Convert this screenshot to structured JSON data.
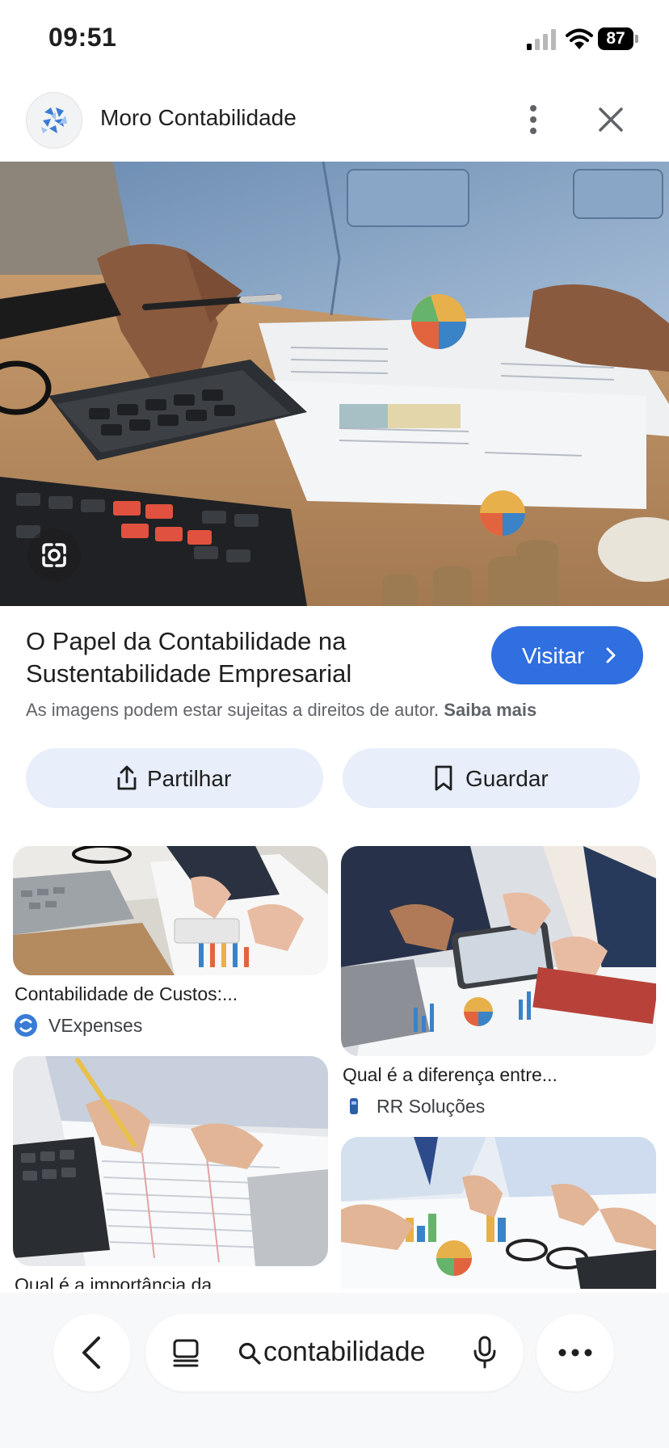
{
  "status_bar": {
    "time": "09:51",
    "battery": "87"
  },
  "header": {
    "site_name": "Moro Contabilidade"
  },
  "result": {
    "title_line1": "O Papel da Contabilidade na",
    "title_line2": "Sustentabilidade Empresarial",
    "visit_label": "Visitar",
    "copyright_text": "As imagens podem estar sujeitas a direitos de autor.",
    "learn_more": "Saiba mais",
    "share_label": "Partilhar",
    "save_label": "Guardar"
  },
  "related": [
    {
      "title": "Contabilidade de Custos:...",
      "source": "VExpenses"
    },
    {
      "title": "Qual é a diferença entre...",
      "source": "RR Soluções"
    },
    {
      "title": "Qual é a importância da...",
      "source": ""
    },
    {
      "title": "",
      "source": ""
    }
  ],
  "bottom_bar": {
    "query": "contabilidade"
  },
  "colors": {
    "accent": "#2f6fdf",
    "pill_bg": "#e8eefa",
    "text": "#1f1f1f",
    "muted": "#5f6368"
  },
  "icons": [
    "signal-icon",
    "wifi-icon",
    "battery-icon",
    "more-vert-icon",
    "close-icon",
    "lens-icon",
    "chevron-right-icon",
    "share-icon",
    "bookmark-icon",
    "back-icon",
    "tabs-icon",
    "search-icon",
    "mic-icon",
    "more-horiz-icon"
  ]
}
